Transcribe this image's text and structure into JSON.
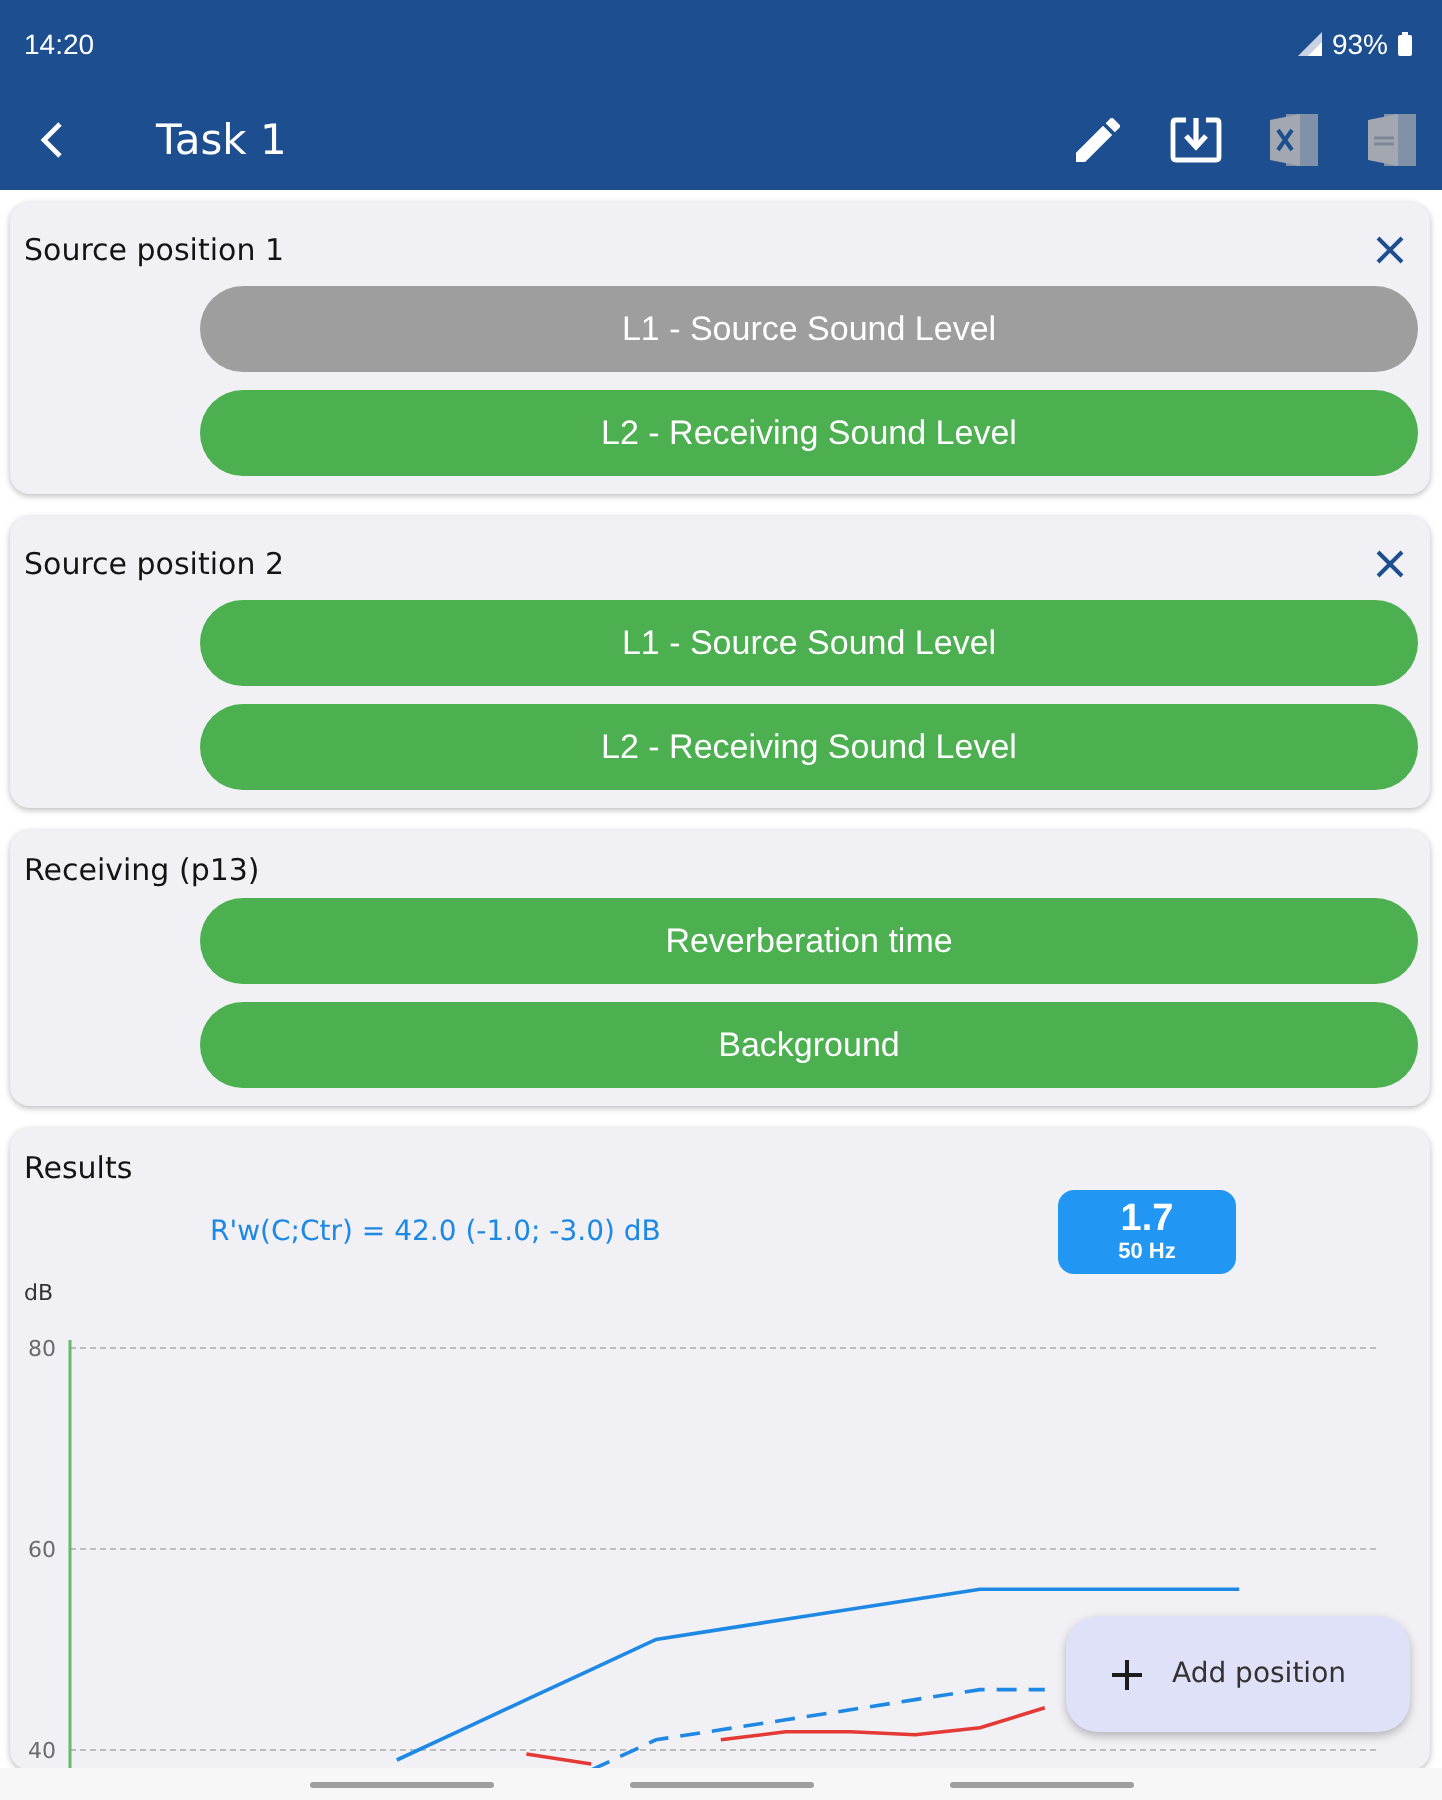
{
  "status_bar": {
    "time": "14:20",
    "battery": "93%"
  },
  "app_bar": {
    "title": "Task 1",
    "actions": [
      {
        "kind": "edit",
        "disabled": false
      },
      {
        "kind": "download",
        "disabled": false
      },
      {
        "kind": "spreadsheet",
        "disabled": true
      },
      {
        "kind": "pdf",
        "disabled": true
      }
    ]
  },
  "positions": [
    {
      "title": "Source position 1",
      "closable": true,
      "measurements": [
        {
          "label": "L1 - Source Sound Level",
          "completed": false
        },
        {
          "label": "L2 - Receiving Sound Level",
          "completed": true
        }
      ]
    },
    {
      "title": "Source position 2",
      "closable": true,
      "measurements": [
        {
          "label": "L1 - Source Sound Level",
          "completed": true
        },
        {
          "label": "L2 - Receiving Sound Level",
          "completed": true
        }
      ]
    },
    {
      "title": "Receiving (p13)",
      "closable": false,
      "measurements": [
        {
          "label": "Reverberation time",
          "completed": true
        },
        {
          "label": "Background",
          "completed": true
        }
      ]
    }
  ],
  "results": {
    "title": "Results",
    "summary": "R'w(C;Ctr) = 42.0 (-1.0; -3.0) dB",
    "badge": {
      "value": "1.7",
      "frequency": "50 Hz"
    },
    "chart_data": {
      "type": "line",
      "ylabel": "dB",
      "categories": [
        null,
        null,
        null,
        null,
        null,
        null,
        null,
        null,
        null,
        null,
        null,
        null,
        null,
        null,
        null,
        null,
        null,
        null,
        null
      ],
      "ylim": [
        38,
        80.8
      ],
      "yticks": [
        40,
        60,
        80
      ],
      "grid": true,
      "series": [
        {
          "color": "#1e88e5",
          "values": [
            null,
            null,
            null,
            null,
            null,
            39,
            42,
            45,
            48,
            51,
            52,
            53,
            54,
            55,
            56,
            56,
            56,
            56,
            56
          ]
        },
        {
          "color": "#1e88e5",
          "line_style": "dashed",
          "values": [
            null,
            null,
            null,
            null,
            null,
            null,
            null,
            null,
            38,
            41,
            42,
            43,
            44,
            45,
            46,
            46,
            null,
            null,
            null
          ]
        },
        {
          "color": "#e53935",
          "values": [
            null,
            null,
            null,
            null,
            null,
            null,
            null,
            39.6,
            38.6,
            null,
            41,
            41.8,
            41.8,
            41.5,
            42.2,
            44.2,
            null,
            null,
            null
          ]
        }
      ]
    }
  },
  "fab": {
    "label": "Add position"
  }
}
